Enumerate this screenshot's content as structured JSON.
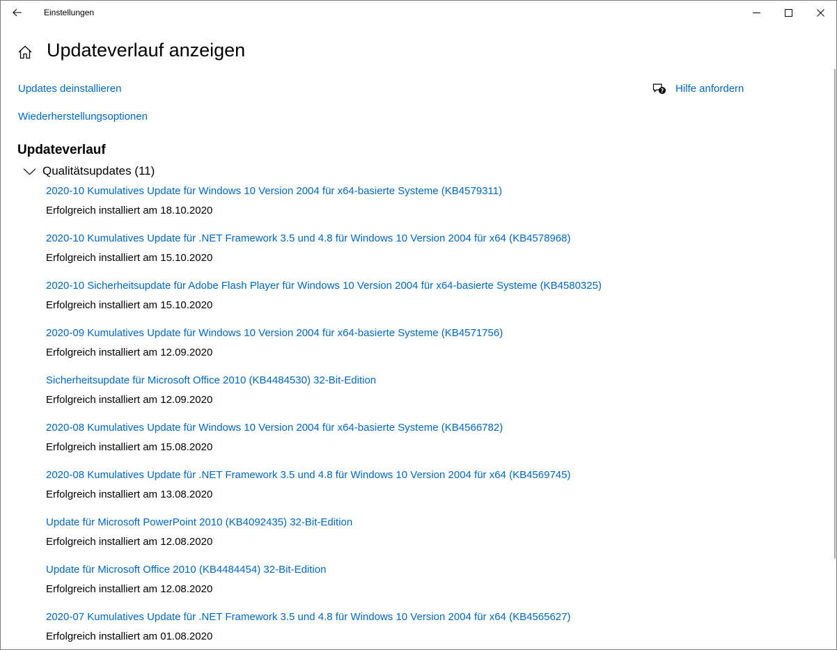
{
  "window": {
    "title": "Einstellungen",
    "icons": {
      "back": "back-arrow-icon",
      "minimize": "minimize-icon",
      "maximize": "maximize-icon",
      "close": "close-icon"
    }
  },
  "header": {
    "home_icon": "home-icon",
    "title": "Updateverlauf anzeigen"
  },
  "links": {
    "uninstall": "Updates deinstallieren",
    "recovery": "Wiederherstellungsoptionen",
    "help": "Hilfe anfordern",
    "help_icon": "help-chat-icon"
  },
  "history": {
    "heading": "Updateverlauf",
    "group": {
      "label": "Qualitätsupdates (11)",
      "expanded": true,
      "items": [
        {
          "title": "2020-10 Kumulatives Update für Windows 10 Version 2004 für x64-basierte Systeme (KB4579311)",
          "status": "Erfolgreich installiert am 18.10.2020"
        },
        {
          "title": "2020-10 Kumulatives Update für .NET Framework 3.5 und 4.8 für Windows 10 Version 2004 für x64 (KB4578968)",
          "status": "Erfolgreich installiert am 15.10.2020"
        },
        {
          "title": "2020-10 Sicherheitsupdate für Adobe Flash Player für Windows 10 Version 2004 für x64-basierte Systeme (KB4580325)",
          "status": "Erfolgreich installiert am 15.10.2020"
        },
        {
          "title": "2020-09 Kumulatives Update für Windows 10 Version 2004 für x64-basierte Systeme (KB4571756)",
          "status": "Erfolgreich installiert am 12.09.2020"
        },
        {
          "title": "Sicherheitsupdate für Microsoft Office 2010 (KB4484530) 32-Bit-Edition",
          "status": "Erfolgreich installiert am 12.09.2020"
        },
        {
          "title": "2020-08 Kumulatives Update für Windows 10 Version 2004 für x64-basierte Systeme (KB4566782)",
          "status": "Erfolgreich installiert am 15.08.2020"
        },
        {
          "title": "2020-08 Kumulatives Update für .NET Framework 3.5 und 4.8 für Windows 10 Version 2004 für x64 (KB4569745)",
          "status": "Erfolgreich installiert am 13.08.2020"
        },
        {
          "title": "Update für Microsoft PowerPoint 2010 (KB4092435) 32-Bit-Edition",
          "status": "Erfolgreich installiert am 12.08.2020"
        },
        {
          "title": "Update für Microsoft Office 2010 (KB4484454) 32-Bit-Edition",
          "status": "Erfolgreich installiert am 12.08.2020"
        },
        {
          "title": "2020-07 Kumulatives Update für .NET Framework 3.5 und 4.8 für Windows 10 Version 2004 für x64 (KB4565627)",
          "status": "Erfolgreich installiert am 01.08.2020"
        }
      ]
    }
  },
  "colors": {
    "link": "#0067c0",
    "text": "#000000",
    "background": "#ffffff"
  }
}
